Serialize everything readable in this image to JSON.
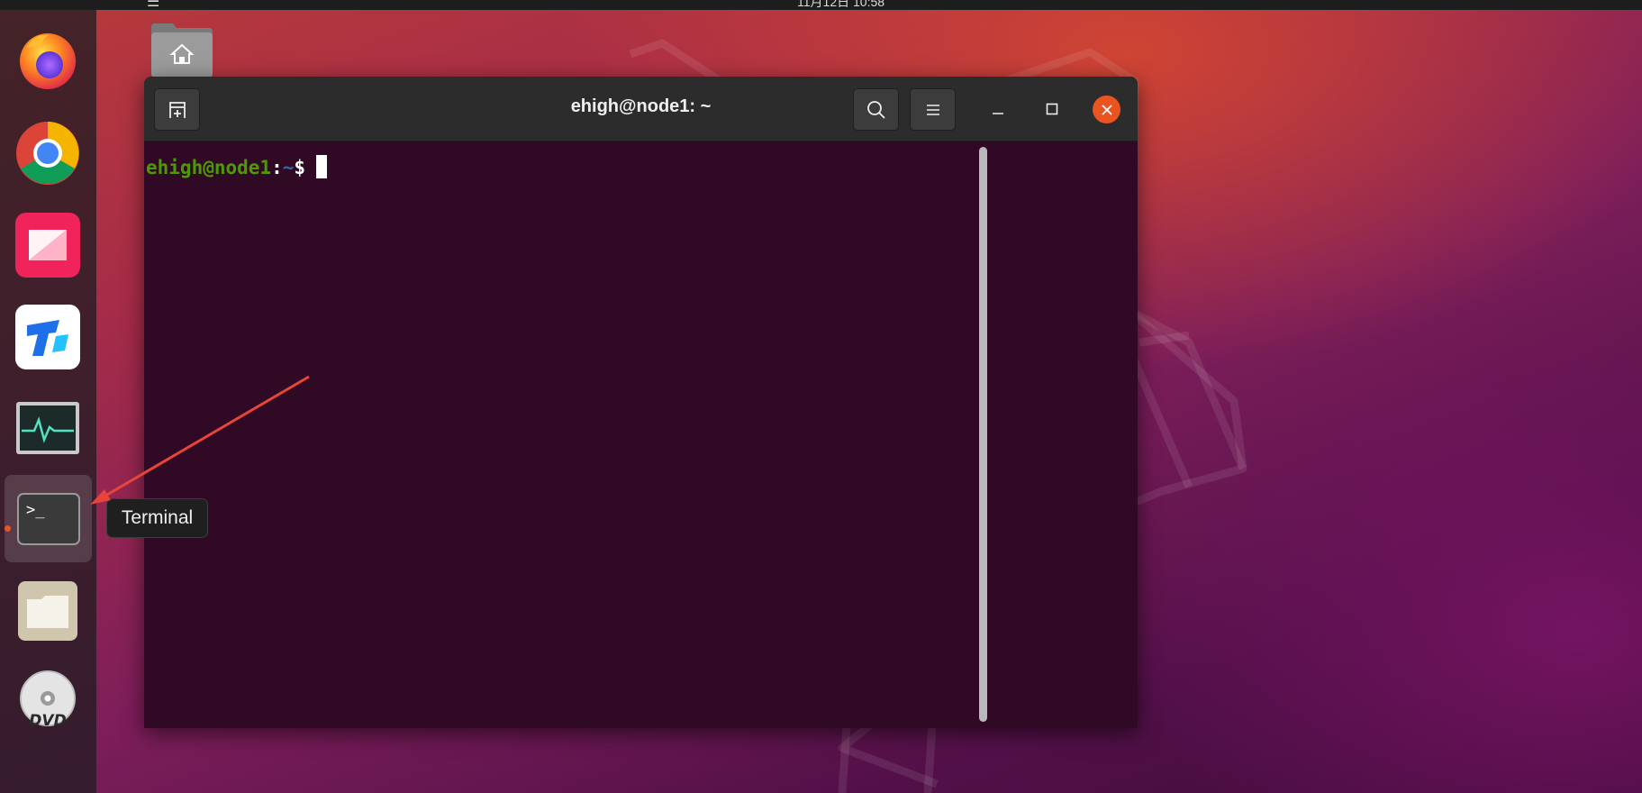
{
  "topbar": {
    "menu_glyph": "☰",
    "clock": "11月12日  10:58"
  },
  "dock": {
    "items": [
      {
        "name": "Firefox",
        "icon": "firefox-icon"
      },
      {
        "name": "Chrome",
        "icon": "chrome-icon"
      },
      {
        "name": "Xmind",
        "icon": "xmind-icon"
      },
      {
        "name": "ToDesk",
        "icon": "todesk-icon"
      },
      {
        "name": "System Monitor",
        "icon": "system-monitor-icon"
      },
      {
        "name": "Terminal",
        "icon": "terminal-icon",
        "running": true
      },
      {
        "name": "Files",
        "icon": "files-icon"
      },
      {
        "name": "DVD",
        "icon": "dvd-icon",
        "label": "DVD"
      }
    ],
    "terminal_glyph": ">_"
  },
  "desktop": {
    "folder_icon": "home-folder-icon"
  },
  "terminal": {
    "title": "ehigh@node1: ~",
    "prompt_user": "ehigh@node1",
    "prompt_sep": ":",
    "prompt_path": "~",
    "prompt_dollar": "$"
  },
  "tooltip": {
    "text": "Terminal"
  },
  "colors": {
    "accent_orange": "#e95420",
    "terminal_bg": "#300a24",
    "prompt_green": "#4e9a06",
    "prompt_blue": "#3465a4",
    "annotation_arrow": "#e8453a"
  }
}
